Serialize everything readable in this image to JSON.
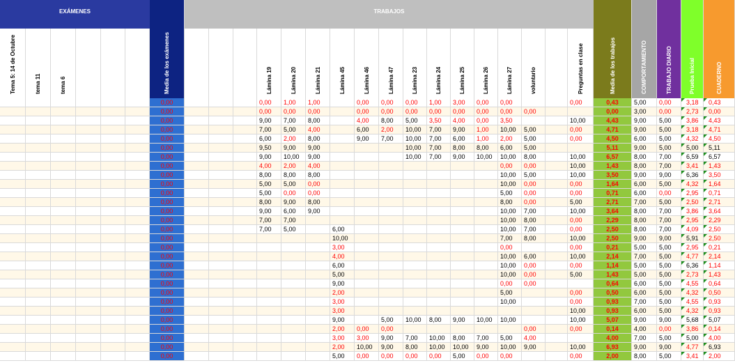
{
  "headers": {
    "examenes_title": "EXÁMENES",
    "trabajos_title": "TRABAJOS",
    "examenes_cols": [
      "Tema 5: 14 de Octubre",
      "tema 11",
      "tema 6"
    ],
    "media_examenes": "Media de los exámenes",
    "trabajos_cols": [
      "Lámina 19",
      "Lámina 20",
      "Lámina 21",
      "Lámina 45",
      "Lámina 46",
      "Lámina 47",
      "Lámina 23",
      "Lámina 24",
      "Lámina 25",
      "Lámina 26",
      "Lámina 27",
      "voluntario",
      "Preguntas en clase"
    ],
    "media_trabajos": "Media de los trabajos",
    "comportamiento": "COMPORTAMIENTO",
    "trabajo_diario": "TRABAJO DIARIO",
    "prueba_inicial": "Prueba Inicial",
    "cuaderno": "CUADERNO"
  },
  "colors": {
    "navy": "#0d2382",
    "blue_cell": "#2e6fd1",
    "gray": "#bfbfbf",
    "olive": "#7b7b1c",
    "olive_cell": "#92c83e",
    "silver": "#a6a6a6",
    "purple": "#70309e",
    "lime": "#7fff2a",
    "orange": "#f79a2e",
    "cream": "#fff8e8"
  },
  "rows": [
    {
      "m": "0,00",
      "l19": "0,00",
      "l20": "1,00",
      "l21": "1,00",
      "l45": "",
      "l46": "0,00",
      "l47": "0,00",
      "l23": "0,00",
      "l24": "1,00",
      "l25": "3,00",
      "l26": "0,00",
      "l27": "0,00",
      "vol": "",
      "preg": "0,00",
      "mt": "0,43",
      "comp": "5,00",
      "td": "0,00",
      "pi": "3,18",
      "cua": "0,43"
    },
    {
      "m": "0,00",
      "l19": "0,00",
      "l20": "0,00",
      "l21": "0,00",
      "l45": "",
      "l46": "0,00",
      "l47": "0,00",
      "l23": "0,00",
      "l24": "0,00",
      "l25": "0,00",
      "l26": "0,00",
      "l27": "0,00",
      "vol": "0,00",
      "preg": "",
      "mt": "0,00",
      "comp": "3,00",
      "td": "0,00",
      "pi": "2,73",
      "cua": "0,00"
    },
    {
      "m": "0,00",
      "l19": "9,00",
      "l20": "7,00",
      "l21": "8,00",
      "l45": "",
      "l46": "4,00",
      "l47": "8,00",
      "l23": "5,00",
      "l24": "3,50",
      "l25": "4,00",
      "l26": "0,00",
      "l27": "3,50",
      "vol": "",
      "preg": "10,00",
      "mt": "4,43",
      "comp": "9,00",
      "td": "5,00",
      "pi": "3,86",
      "cua": "4,43"
    },
    {
      "m": "0,00",
      "l19": "7,00",
      "l20": "5,00",
      "l21": "4,00",
      "l45": "",
      "l46": "6,00",
      "l47": "2,00",
      "l23": "10,00",
      "l24": "7,00",
      "l25": "9,00",
      "l26": "1,00",
      "l27": "10,00",
      "vol": "5,00",
      "preg": "0,00",
      "mt": "4,71",
      "comp": "9,00",
      "td": "5,00",
      "pi": "3,18",
      "cua": "4,71"
    },
    {
      "m": "0,00",
      "l19": "6,00",
      "l20": "2,00",
      "l21": "8,00",
      "l45": "",
      "l46": "9,00",
      "l47": "7,00",
      "l23": "10,00",
      "l24": "7,00",
      "l25": "6,00",
      "l26": "1,00",
      "l27": "2,00",
      "vol": "5,00",
      "preg": "0,00",
      "mt": "4,50",
      "comp": "6,00",
      "td": "5,00",
      "pi": "4,32",
      "cua": "4,50"
    },
    {
      "m": "0,00",
      "l19": "9,50",
      "l20": "9,00",
      "l21": "9,00",
      "l45": "",
      "l46": "",
      "l47": "",
      "l23": "10,00",
      "l24": "7,00",
      "l25": "8,00",
      "l26": "8,00",
      "l27": "6,00",
      "vol": "5,00",
      "preg": "",
      "mt": "5,11",
      "comp": "9,00",
      "td": "5,00",
      "pi": "5,00",
      "cua": "5,11"
    },
    {
      "m": "0,00",
      "l19": "9,00",
      "l20": "10,00",
      "l21": "9,00",
      "l45": "",
      "l46": "",
      "l47": "",
      "l23": "10,00",
      "l24": "7,00",
      "l25": "9,00",
      "l26": "10,00",
      "l27": "10,00",
      "vol": "8,00",
      "preg": "10,00",
      "mt": "6,57",
      "comp": "8,00",
      "td": "7,00",
      "pi": "6,59",
      "cua": "6,57"
    },
    {
      "m": "0,00",
      "l19": "4,00",
      "l20": "2,00",
      "l21": "4,00",
      "l45": "",
      "l46": "",
      "l47": "",
      "l23": "",
      "l24": "",
      "l25": "",
      "l26": "",
      "l27": "0,00",
      "vol": "0,00",
      "preg": "10,00",
      "mt": "1,43",
      "comp": "8,00",
      "td": "7,00",
      "pi": "3,41",
      "cua": "1,43"
    },
    {
      "m": "0,00",
      "l19": "8,00",
      "l20": "8,00",
      "l21": "8,00",
      "l45": "",
      "l46": "",
      "l47": "",
      "l23": "",
      "l24": "",
      "l25": "",
      "l26": "",
      "l27": "10,00",
      "vol": "5,00",
      "preg": "10,00",
      "mt": "3,50",
      "comp": "9,00",
      "td": "9,00",
      "pi": "6,36",
      "cua": "3,50"
    },
    {
      "m": "0,00",
      "l19": "5,00",
      "l20": "5,00",
      "l21": "0,00",
      "l45": "",
      "l46": "",
      "l47": "",
      "l23": "",
      "l24": "",
      "l25": "",
      "l26": "",
      "l27": "10,00",
      "vol": "0,00",
      "preg": "0,00",
      "mt": "1,64",
      "comp": "6,00",
      "td": "5,00",
      "pi": "4,32",
      "cua": "1,64"
    },
    {
      "m": "0,00",
      "l19": "5,00",
      "l20": "0,00",
      "l21": "0,00",
      "l45": "",
      "l46": "",
      "l47": "",
      "l23": "",
      "l24": "",
      "l25": "",
      "l26": "",
      "l27": "5,00",
      "vol": "0,00",
      "preg": "0,00",
      "mt": "0,71",
      "comp": "6,00",
      "td": "0,00",
      "pi": "2,95",
      "cua": "0,71"
    },
    {
      "m": "0,00",
      "l19": "8,00",
      "l20": "9,00",
      "l21": "8,00",
      "l45": "",
      "l46": "",
      "l47": "",
      "l23": "",
      "l24": "",
      "l25": "",
      "l26": "",
      "l27": "8,00",
      "vol": "0,00",
      "preg": "5,00",
      "mt": "2,71",
      "comp": "7,00",
      "td": "5,00",
      "pi": "2,50",
      "cua": "2,71"
    },
    {
      "m": "0,00",
      "l19": "9,00",
      "l20": "6,00",
      "l21": "9,00",
      "l45": "",
      "l46": "",
      "l47": "",
      "l23": "",
      "l24": "",
      "l25": "",
      "l26": "",
      "l27": "10,00",
      "vol": "7,00",
      "preg": "10,00",
      "mt": "3,64",
      "comp": "8,00",
      "td": "7,00",
      "pi": "3,86",
      "cua": "3,64"
    },
    {
      "m": "0,00",
      "l19": "7,00",
      "l20": "7,00",
      "l21": "",
      "l45": "",
      "l46": "",
      "l47": "",
      "l23": "",
      "l24": "",
      "l25": "",
      "l26": "",
      "l27": "10,00",
      "vol": "8,00",
      "preg": "0,00",
      "mt": "2,29",
      "comp": "8,00",
      "td": "7,00",
      "pi": "2,95",
      "cua": "2,29"
    },
    {
      "m": "0,00",
      "l19": "7,00",
      "l20": "5,00",
      "l21": "",
      "l45": "6,00",
      "l46": "",
      "l47": "",
      "l23": "",
      "l24": "",
      "l25": "",
      "l26": "",
      "l27": "10,00",
      "vol": "7,00",
      "preg": "0,00",
      "mt": "2,50",
      "comp": "8,00",
      "td": "7,00",
      "pi": "4,09",
      "cua": "2,50"
    },
    {
      "m": "0,00",
      "l19": "",
      "l20": "",
      "l21": "",
      "l45": "10,00",
      "l46": "",
      "l47": "",
      "l23": "",
      "l24": "",
      "l25": "",
      "l26": "",
      "l27": "7,00",
      "vol": "8,00",
      "preg": "10,00",
      "mt": "2,50",
      "comp": "9,00",
      "td": "9,00",
      "pi": "5,91",
      "cua": "2,50"
    },
    {
      "m": "0,00",
      "l19": "",
      "l20": "",
      "l21": "",
      "l45": "3,00",
      "l46": "",
      "l47": "",
      "l23": "",
      "l24": "",
      "l25": "",
      "l26": "",
      "l27": "0,00",
      "vol": "",
      "preg": "0,00",
      "mt": "0,21",
      "comp": "5,00",
      "td": "5,00",
      "pi": "2,95",
      "cua": "0,21"
    },
    {
      "m": "0,00",
      "l19": "",
      "l20": "",
      "l21": "",
      "l45": "4,00",
      "l46": "",
      "l47": "",
      "l23": "",
      "l24": "",
      "l25": "",
      "l26": "",
      "l27": "10,00",
      "vol": "6,00",
      "preg": "10,00",
      "mt": "2,14",
      "comp": "7,00",
      "td": "5,00",
      "pi": "4,77",
      "cua": "2,14"
    },
    {
      "m": "0,00",
      "l19": "",
      "l20": "",
      "l21": "",
      "l45": "6,00",
      "l46": "",
      "l47": "",
      "l23": "",
      "l24": "",
      "l25": "",
      "l26": "",
      "l27": "10,00",
      "vol": "0,00",
      "preg": "0,00",
      "mt": "1,14",
      "comp": "5,00",
      "td": "5,00",
      "pi": "6,36",
      "cua": "1,14"
    },
    {
      "m": "0,00",
      "l19": "",
      "l20": "",
      "l21": "",
      "l45": "5,00",
      "l46": "",
      "l47": "",
      "l23": "",
      "l24": "",
      "l25": "",
      "l26": "",
      "l27": "10,00",
      "vol": "0,00",
      "preg": "5,00",
      "mt": "1,43",
      "comp": "5,00",
      "td": "5,00",
      "pi": "2,73",
      "cua": "1,43"
    },
    {
      "m": "0,00",
      "l19": "",
      "l20": "",
      "l21": "",
      "l45": "9,00",
      "l46": "",
      "l47": "",
      "l23": "",
      "l24": "",
      "l25": "",
      "l26": "",
      "l27": "0,00",
      "vol": "0,00",
      "preg": "",
      "mt": "0,64",
      "comp": "6,00",
      "td": "5,00",
      "pi": "4,55",
      "cua": "0,64"
    },
    {
      "m": "0,00",
      "l19": "",
      "l20": "",
      "l21": "",
      "l45": "2,00",
      "l46": "",
      "l47": "",
      "l23": "",
      "l24": "",
      "l25": "",
      "l26": "",
      "l27": "5,00",
      "vol": "",
      "preg": "0,00",
      "mt": "0,50",
      "comp": "6,00",
      "td": "5,00",
      "pi": "4,32",
      "cua": "0,50"
    },
    {
      "m": "0,00",
      "l19": "",
      "l20": "",
      "l21": "",
      "l45": "3,00",
      "l46": "",
      "l47": "",
      "l23": "",
      "l24": "",
      "l25": "",
      "l26": "",
      "l27": "10,00",
      "vol": "",
      "preg": "0,00",
      "mt": "0,93",
      "comp": "7,00",
      "td": "5,00",
      "pi": "4,55",
      "cua": "0,93"
    },
    {
      "m": "0,00",
      "l19": "",
      "l20": "",
      "l21": "",
      "l45": "3,00",
      "l46": "",
      "l47": "",
      "l23": "",
      "l24": "",
      "l25": "",
      "l26": "",
      "l27": "",
      "vol": "",
      "preg": "10,00",
      "mt": "0,93",
      "comp": "6,00",
      "td": "5,00",
      "pi": "4,32",
      "cua": "0,93"
    },
    {
      "m": "0,00",
      "l19": "",
      "l20": "",
      "l21": "",
      "l45": "9,00",
      "l46": "",
      "l47": "5,00",
      "l23": "10,00",
      "l24": "8,00",
      "l25": "9,00",
      "l26": "10,00",
      "l27": "10,00",
      "vol": "",
      "preg": "10,00",
      "mt": "5,07",
      "comp": "9,00",
      "td": "9,00",
      "pi": "5,68",
      "cua": "5,07"
    },
    {
      "m": "0,00",
      "l19": "",
      "l20": "",
      "l21": "",
      "l45": "2,00",
      "l46": "0,00",
      "l47": "0,00",
      "l23": "",
      "l24": "",
      "l25": "",
      "l26": "",
      "l27": "",
      "vol": "0,00",
      "preg": "0,00",
      "mt": "0,14",
      "comp": "4,00",
      "td": "0,00",
      "pi": "3,86",
      "cua": "0,14"
    },
    {
      "m": "0,00",
      "l19": "",
      "l20": "",
      "l21": "",
      "l45": "3,00",
      "l46": "3,00",
      "l47": "9,00",
      "l23": "7,00",
      "l24": "10,00",
      "l25": "8,00",
      "l26": "7,00",
      "l27": "5,00",
      "vol": "4,00",
      "preg": "",
      "mt": "4,00",
      "comp": "7,00",
      "td": "5,00",
      "pi": "5,00",
      "cua": "4,00"
    },
    {
      "m": "0,00",
      "l19": "",
      "l20": "",
      "l21": "",
      "l45": "2,00",
      "l46": "10,00",
      "l47": "9,00",
      "l23": "8,00",
      "l24": "10,00",
      "l25": "10,00",
      "l26": "9,00",
      "l27": "10,00",
      "vol": "9,00",
      "preg": "10,00",
      "mt": "6,93",
      "comp": "9,00",
      "td": "9,00",
      "pi": "4,77",
      "cua": "6,93"
    },
    {
      "m": "0,00",
      "l19": "",
      "l20": "",
      "l21": "",
      "l45": "5,00",
      "l46": "0,00",
      "l47": "0,00",
      "l23": "0,00",
      "l24": "0,00",
      "l25": "5,00",
      "l26": "0,00",
      "l27": "0,00",
      "vol": "",
      "preg": "0,00",
      "mt": "2,00",
      "comp": "8,00",
      "td": "5,00",
      "pi": "3,41",
      "cua": "2,00"
    }
  ]
}
